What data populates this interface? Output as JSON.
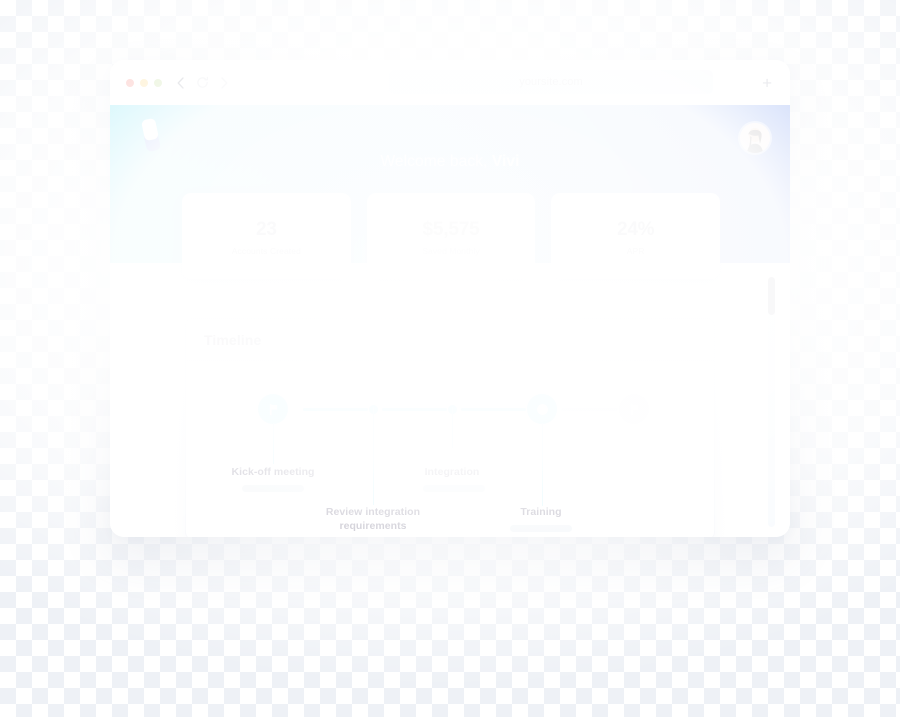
{
  "browser": {
    "traffic_lights": [
      "red",
      "yellow",
      "green"
    ],
    "back_icon": "chevron-left-icon",
    "reload_icon": "reload-icon",
    "forward_icon": "chevron-right-icon",
    "url": "yoursite.com",
    "new_tab_label": "+"
  },
  "app": {
    "logo_name": "brand-logo",
    "welcome_prefix": "Welcome back, ",
    "welcome_user": "Vivi",
    "avatar_label": "user-avatar"
  },
  "stats": [
    {
      "value": "23",
      "label": "Accounts Created"
    },
    {
      "value": "$5,575",
      "label": "Saved Monthly"
    },
    {
      "value": "24%",
      "label": "APR"
    }
  ],
  "timeline": {
    "title": "Timeline",
    "milestones": [
      {
        "label": "Kick-off meeting",
        "type": "flag-active",
        "state": "complete"
      },
      {
        "label": "Review integration requirements",
        "type": "dot-active",
        "state": "complete"
      },
      {
        "label": "Integration",
        "type": "dot-active",
        "state": "complete"
      },
      {
        "label": "Training",
        "type": "ring-active",
        "state": "current"
      },
      {
        "label": "",
        "type": "flag-inactive",
        "state": "upcoming"
      }
    ]
  },
  "scrollbar": {
    "name": "vertical-scrollbar",
    "thumb_position": "top"
  },
  "colors": {
    "accent_cyan": "#3cd7f5",
    "accent_blue": "#2457e6",
    "ink": "#2a2546",
    "muted_bar": "#e2eaf0",
    "scrollbar_thumb": "#2b2145"
  }
}
